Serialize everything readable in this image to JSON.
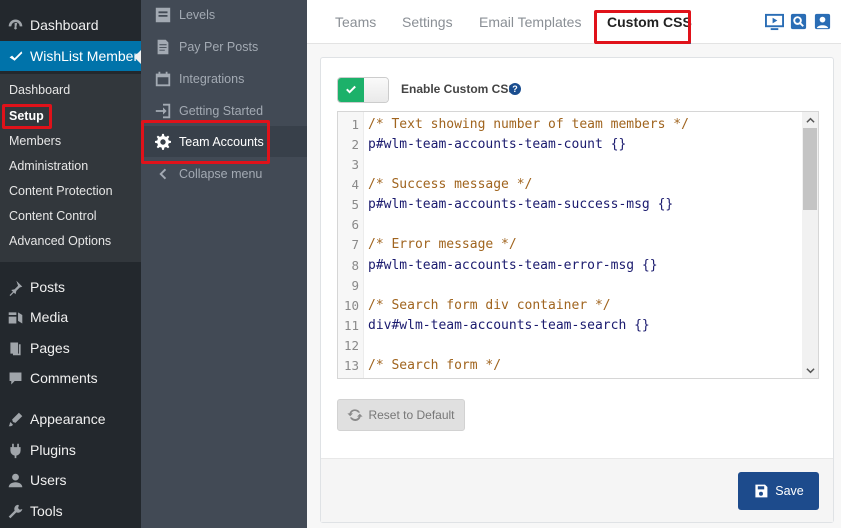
{
  "wp_menu": {
    "dashboard": "Dashboard",
    "wishlist": "WishList Member",
    "submenu": [
      "Dashboard",
      "Setup",
      "Members",
      "Administration",
      "Content Protection",
      "Content Control",
      "Advanced Options"
    ],
    "items": [
      "Posts",
      "Media",
      "Pages",
      "Comments",
      "Appearance",
      "Plugins",
      "Users",
      "Tools"
    ]
  },
  "wlm_menu": {
    "items": [
      "Levels",
      "Pay Per Posts",
      "Integrations",
      "Getting Started",
      "Team Accounts"
    ],
    "collapse": "Collapse menu"
  },
  "tabs": [
    "Teams",
    "Settings",
    "Email Templates",
    "Custom CSS"
  ],
  "active_tab": "Custom CSS",
  "enable_label": "Enable Custom CSS",
  "help_glyph": "?",
  "toggle_enabled": true,
  "editor": {
    "line_numbers": [
      "1",
      "2",
      "3",
      "4",
      "5",
      "6",
      "7",
      "8",
      "9",
      "10",
      "11",
      "12",
      "13"
    ],
    "lines": [
      "/* Text showing number of team members */",
      "p#wlm-team-accounts-team-count {}",
      "",
      "/* Success message */",
      "p#wlm-team-accounts-team-success-msg {}",
      "",
      "/* Error message */",
      "p#wlm-team-accounts-team-error-msg {}",
      "",
      "/* Search form div container */",
      "div#wlm-team-accounts-team-search {}",
      "",
      "/* Search form */"
    ]
  },
  "reset_label": "Reset to Default",
  "save_label": "Save",
  "colors": {
    "accent": "#0073aa",
    "save": "#1d4b8c",
    "toggle_on": "#1cb16a",
    "highlight": "#e0121a"
  },
  "icons": [
    "posts-icon",
    "media-icon",
    "pages-icon",
    "comments-icon",
    "appearance-icon",
    "plugins-icon",
    "users-icon",
    "tools-icon",
    "video-icon",
    "search-doc-icon",
    "user-card-icon"
  ]
}
